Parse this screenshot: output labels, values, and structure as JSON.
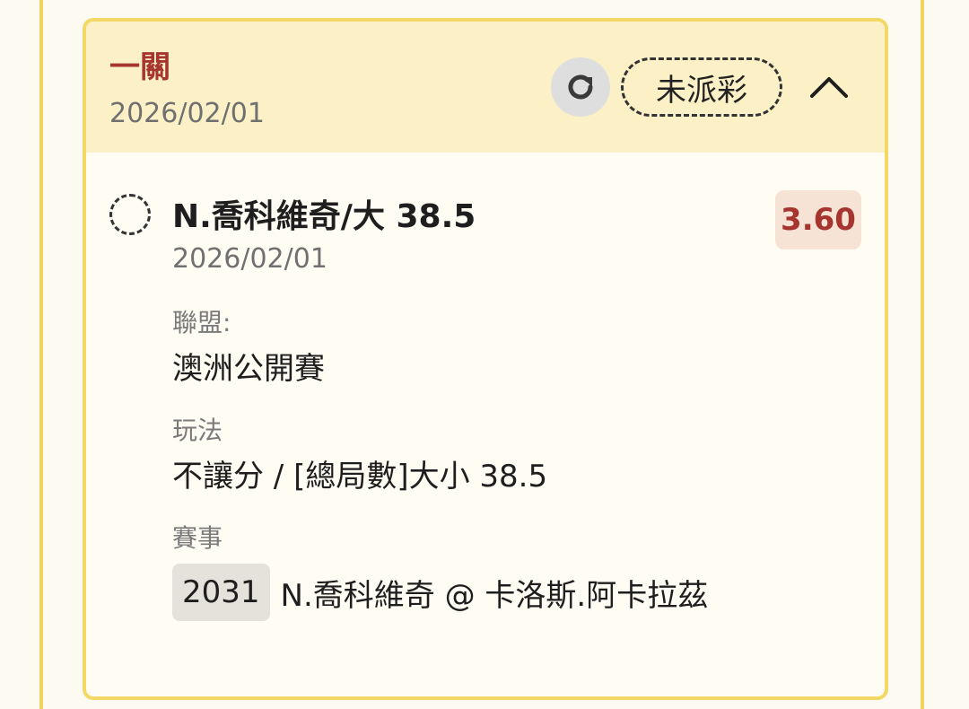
{
  "header": {
    "bet_type": "一關",
    "date": "2026/02/01",
    "status": "未派彩",
    "icons": {
      "refresh": "refresh-icon",
      "collapse": "chevron-up-icon"
    }
  },
  "selection": {
    "name": "N.喬科維奇/大 38.5",
    "date": "2026/02/01",
    "odds": "3.60",
    "league_label": "聯盟:",
    "league_value": "澳洲公開賽",
    "market_label": "玩法",
    "market_value": "不讓分 / [總局數]大小 38.5",
    "event_label": "賽事",
    "event_code": "2031",
    "event_name": "N.喬科維奇 @ 卡洛斯.阿卡拉茲"
  },
  "colors": {
    "accent_red": "#a5352e",
    "header_bg": "#fbf0c6",
    "border_yellow": "#f4d865",
    "odds_bg": "#f6e3d6"
  }
}
